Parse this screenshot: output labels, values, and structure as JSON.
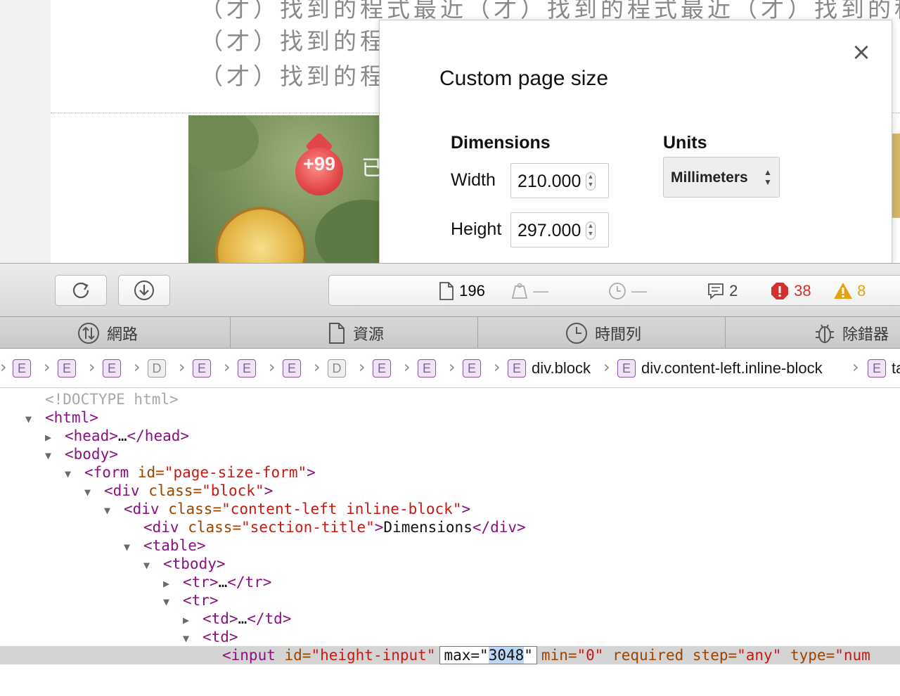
{
  "background_page": {
    "lines": [
      "（才）找到的程式最近（才）找到的程式最近（才）找到的程",
      "（才）找到的程式最近",
      "（才）找到的程式最近"
    ],
    "game_badge_text": "+99",
    "game_text": "已"
  },
  "modal": {
    "title": "Custom page size",
    "dimensions_label": "Dimensions",
    "width_label": "Width",
    "width_value": "210.000",
    "height_label": "Height",
    "height_value": "297.000",
    "units_label": "Units",
    "units_value": "Millimeters"
  },
  "toolbar": {
    "resources_count": "196",
    "size_value": "—",
    "time_value": "—",
    "messages_count": "2",
    "errors_count": "38",
    "warnings_count": "8",
    "colors": {
      "error": "#d22f2f",
      "warning": "#e6a10c"
    }
  },
  "tabs": [
    {
      "label": "網路",
      "icon": "network-icon"
    },
    {
      "label": "資源",
      "icon": "resources-icon"
    },
    {
      "label": "時間列",
      "icon": "timeline-icon"
    },
    {
      "label": "除錯器",
      "icon": "debugger-icon"
    }
  ],
  "breadcrumb": {
    "items": [
      "E",
      "E",
      "E",
      "D",
      "E",
      "E",
      "E",
      "D",
      "E",
      "E",
      "E"
    ],
    "named": [
      {
        "badge": "E",
        "text": "div.block"
      },
      {
        "badge": "E",
        "text": "div.content-left.inline-block"
      },
      {
        "badge": "E",
        "text": "ta"
      }
    ]
  },
  "dom_tree": {
    "doctype": "<!DOCTYPE html>",
    "html_open": "<html>",
    "head": "<head>",
    "ellipsis": "…",
    "head_close": "</head>",
    "body_open": "<body>",
    "form_tag": "<form",
    "form_attr_name": "id=",
    "form_attr_value": "\"page-size-form\"",
    "tag_close_bracket": ">",
    "div_tag": "<div",
    "class_attr": "class=",
    "block_value": "\"block\"",
    "content_left_value": "\"content-left inline-block\"",
    "section_title_value": "\"section-title\"",
    "section_title_text": "Dimensions",
    "div_close": "</div>",
    "table_open": "<table>",
    "tbody_open": "<tbody>",
    "tr_open": "<tr>",
    "tr_close": "</tr>",
    "td_open": "<td>",
    "td_close": "</td>",
    "input_tag": "<input",
    "id_attr": "id=",
    "input_id_value": "\"height-input\"",
    "edit_prefix": "max=\"",
    "edit_selected": "3048",
    "edit_suffix": "\"",
    "min_attr": "min=",
    "min_value": "\"0\"",
    "required_attr": "required",
    "step_attr": "step=",
    "step_value": "\"any\"",
    "type_attr": "type=",
    "type_value": "\"num"
  }
}
